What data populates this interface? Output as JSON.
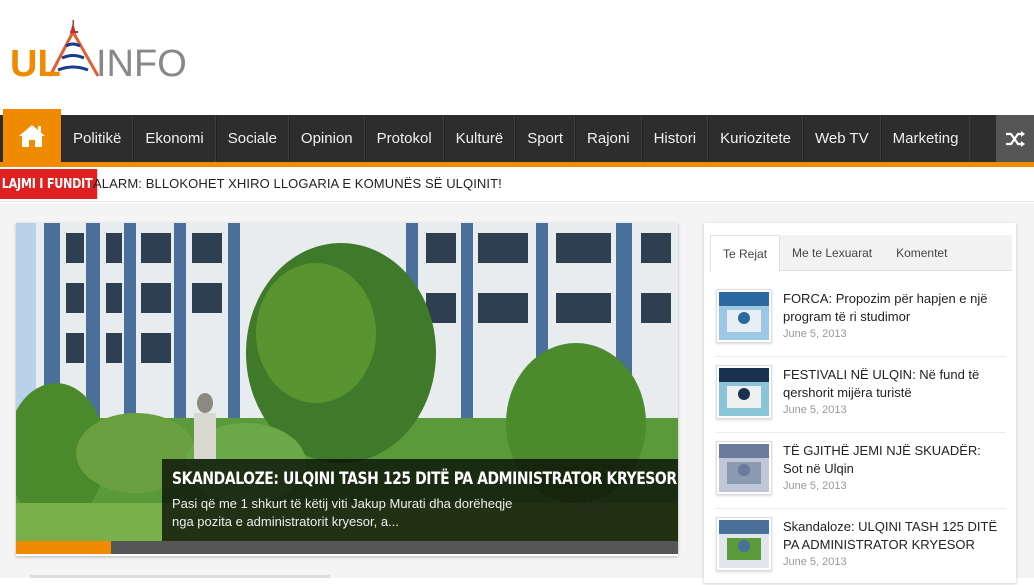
{
  "logo": {
    "text_left": "UL",
    "text_right": "INFO"
  },
  "nav": {
    "home_icon": "home-icon",
    "shuffle_icon": "shuffle-icon",
    "items": [
      "Politikë",
      "Ekonomi",
      "Sociale",
      "Opinion",
      "Protokol",
      "Kulturë",
      "Sport",
      "Rajoni",
      "Histori",
      "Kuriozitete",
      "Web TV",
      "Marketing"
    ]
  },
  "breaking": {
    "label": "LAJMI I FUNDIT",
    "text": "ALARM: BLLOKOHET XHIRO LLOGARIA E KOMUNËS SË ULQINIT!"
  },
  "slider": {
    "title": "SKANDALOZE: ULQINI TASH 125 DITË PA ADMINISTRATOR KRYESOR",
    "excerpt": "Pasi që me 1 shkurt të këtij viti Jakup Murati dha dorëheqje nga pozita e administratorit kryesor, a...",
    "watermark": "/blog",
    "progress": 0.143
  },
  "sidebar": {
    "tabs": [
      "Te Rejat",
      "Me te Lexuarat",
      "Komentet"
    ],
    "posts": [
      {
        "title": "FORCA: Propozim për hapjen e një program të ri studimor",
        "date": "June 5, 2013"
      },
      {
        "title": "FESTIVALI NË ULQIN: Në fund të qershorit mijëra turistë",
        "date": "June 5, 2013"
      },
      {
        "title": "TË GJITHË JEMI NJË SKUADËR: Sot në Ulqin",
        "date": "June 5, 2013"
      },
      {
        "title": "Skandaloze: ULQINI TASH 125 DITË PA ADMINISTRATOR KRYESOR",
        "date": "June 5, 2013"
      }
    ]
  },
  "colors": {
    "accent": "#f08a00",
    "nav_bg": "#2d2d2d",
    "breaking": "#e02020"
  }
}
